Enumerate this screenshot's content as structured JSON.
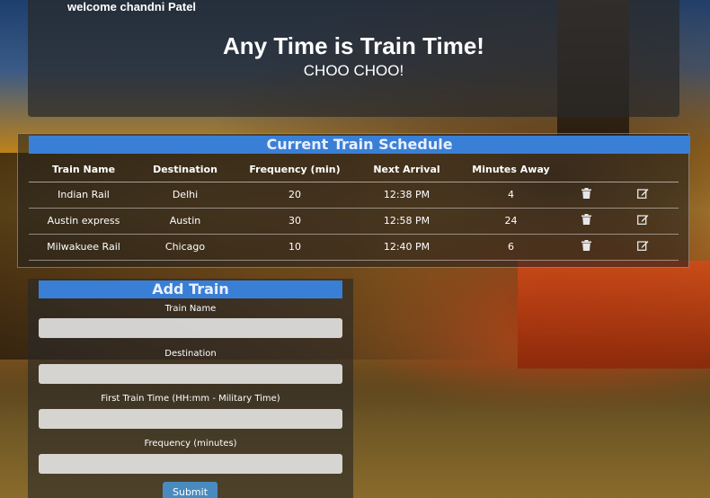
{
  "header": {
    "welcome": "welcome chandni Patel",
    "title": "Any Time is Train Time!",
    "subtitle": "CHOO CHOO!"
  },
  "schedule": {
    "title": "Current Train Schedule",
    "columns": [
      "Train Name",
      "Destination",
      "Frequency (min)",
      "Next Arrival",
      "Minutes Away"
    ],
    "rows": [
      {
        "name": "Indian Rail",
        "destination": "Delhi",
        "frequency": "20",
        "next_arrival": "12:38 PM",
        "minutes_away": "4"
      },
      {
        "name": "Austin express",
        "destination": "Austin",
        "frequency": "30",
        "next_arrival": "12:58 PM",
        "minutes_away": "24"
      },
      {
        "name": "Milwakuee Rail",
        "destination": "Chicago",
        "frequency": "10",
        "next_arrival": "12:40 PM",
        "minutes_away": "6"
      }
    ],
    "icons": {
      "delete": "trash-icon",
      "edit": "edit-icon"
    }
  },
  "add_train": {
    "title": "Add Train",
    "fields": {
      "name": {
        "label": "Train Name",
        "value": "",
        "placeholder": ""
      },
      "destination": {
        "label": "Destination",
        "value": "",
        "placeholder": ""
      },
      "first_time": {
        "label": "First Train Time (HH:mm - Military Time)",
        "value": "",
        "placeholder": ""
      },
      "frequency": {
        "label": "Frequency (minutes)",
        "value": "",
        "placeholder": ""
      }
    },
    "submit_label": "Submit"
  },
  "colors": {
    "header_bar": "#3a7fd6",
    "submit_button": "#4a8bbf"
  }
}
